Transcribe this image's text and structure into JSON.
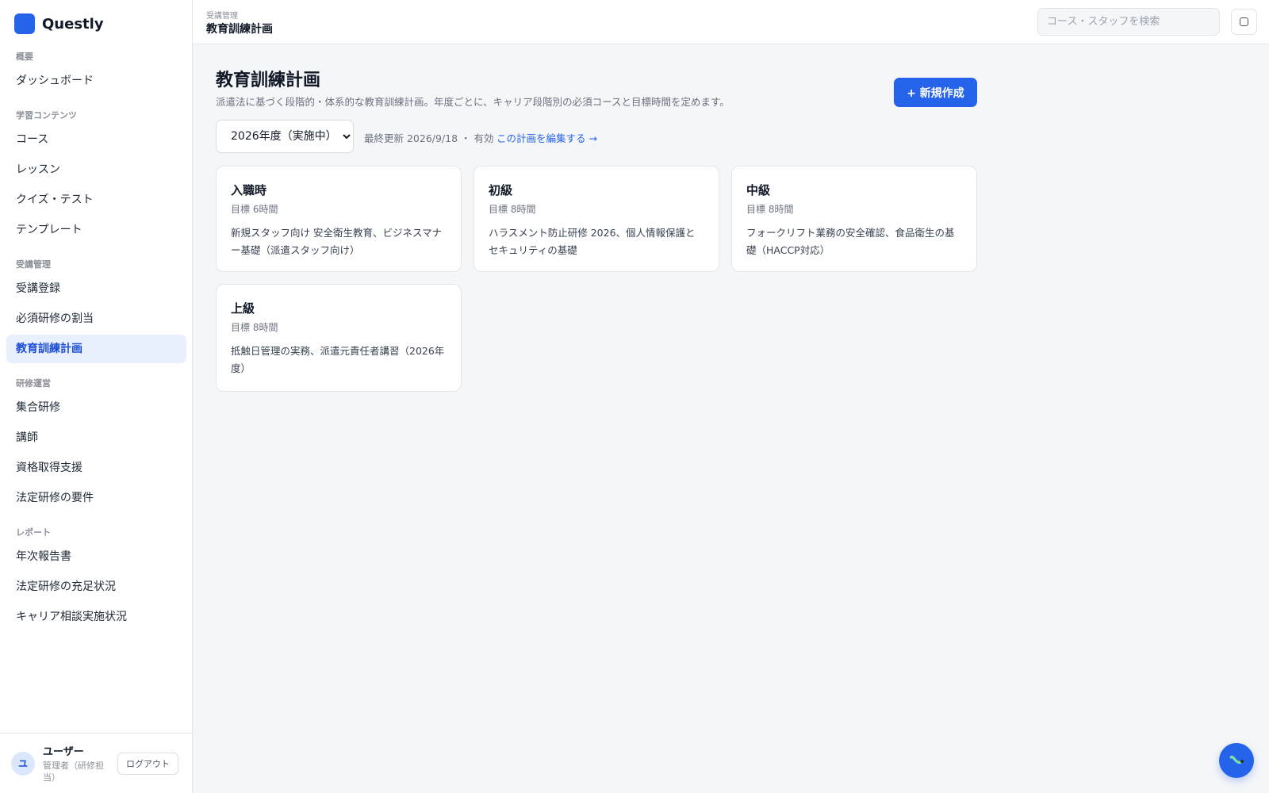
{
  "app": {
    "name": "Questly"
  },
  "sidebar": {
    "sections": [
      {
        "label": "概要",
        "items": [
          "ダッシュボード"
        ]
      },
      {
        "label": "学習コンテンツ",
        "items": [
          "コース",
          "レッスン",
          "クイズ・テスト",
          "テンプレート"
        ]
      },
      {
        "label": "受講管理",
        "items": [
          "受講登録",
          "必須研修の割当",
          "教育訓練計画"
        ]
      },
      {
        "label": "研修運営",
        "items": [
          "集合研修",
          "講師",
          "資格取得支援",
          "法定研修の要件"
        ]
      },
      {
        "label": "レポート",
        "items": [
          "年次報告書",
          "法定研修の充足状況",
          "キャリア相談実施状況"
        ]
      }
    ],
    "active_item": "教育訓練計画",
    "user": {
      "initial": "ユ",
      "name": "ユーザー",
      "role": "管理者（研修担当）",
      "logout_label": "ログアウト"
    }
  },
  "topbar": {
    "breadcrumb": "受講管理",
    "title": "教育訓練計画",
    "search_placeholder": "コース・スタッフを検索"
  },
  "main": {
    "title": "教育訓練計画",
    "description": "派遣法に基づく段階的・体系的な教育訓練計画。年度ごとに、キャリア段階別の必須コースと目標時間を定めます。",
    "new_button_label": "+ 新規作成",
    "year_select": {
      "selected": "2026年度（実施中）"
    },
    "meta": "最終更新 2026/9/18 ・ 有効",
    "edit_link": "この計画を編集する →",
    "cards": [
      {
        "title": "入職時",
        "target": "目標 6時間",
        "description": "新規スタッフ向け 安全衛生教育、ビジネスマナー基礎（派遣スタッフ向け）"
      },
      {
        "title": "初級",
        "target": "目標 8時間",
        "description": "ハラスメント防止研修 2026、個人情報保護とセキュリティの基礎"
      },
      {
        "title": "中級",
        "target": "目標 8時間",
        "description": "フォークリフト業務の安全確認、食品衛生の基礎（HACCP対応）"
      },
      {
        "title": "上級",
        "target": "目標 8時間",
        "description": "抵触日管理の実務、派遣元責任者講習（2026年度）"
      }
    ]
  },
  "icons": {
    "settings_button": "square-icon",
    "fab": "chat-assistant-icon"
  },
  "colors": {
    "accent": "#2563eb",
    "active_bg": "#e8f0fe",
    "background": "#f5f6f8"
  }
}
